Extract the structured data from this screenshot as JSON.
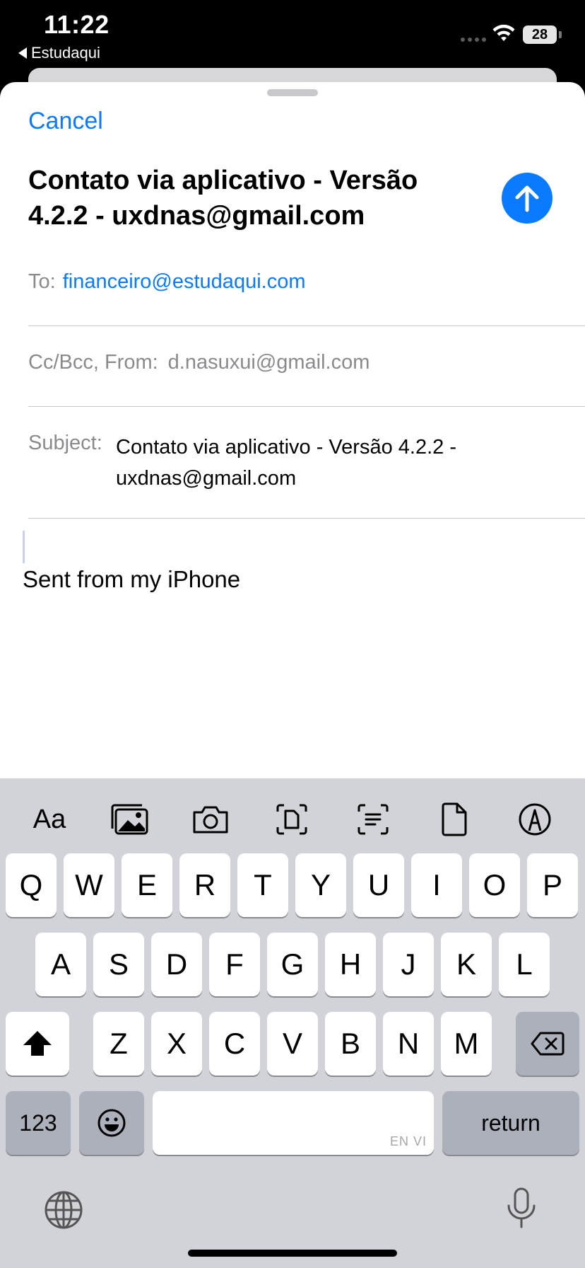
{
  "status_bar": {
    "time": "11:22",
    "back_app": "Estudaqui",
    "battery": "28"
  },
  "compose": {
    "cancel_label": "Cancel",
    "title": "Contato via aplicativo - Versão 4.2.2 - uxdnas@gmail.com",
    "to_label": "To:",
    "to_value": "financeiro@estudaqui.com",
    "cc_label": "Cc/Bcc, From:",
    "cc_value": "d.nasuxui@gmail.com",
    "subject_label": "Subject:",
    "subject_value": "Contato via aplicativo - Versão 4.2.2 - uxdnas@gmail.com",
    "body": "Sent from my iPhone",
    "accent_color": "#0a7aff"
  },
  "keyboard": {
    "toolbar": {
      "format": "Aa",
      "icons": [
        "photo-library-icon",
        "camera-icon",
        "scan-document-icon",
        "scan-text-icon",
        "attach-file-icon",
        "markup-icon"
      ]
    },
    "row1": [
      "Q",
      "W",
      "E",
      "R",
      "T",
      "Y",
      "U",
      "I",
      "O",
      "P"
    ],
    "row2": [
      "A",
      "S",
      "D",
      "F",
      "G",
      "H",
      "J",
      "K",
      "L"
    ],
    "row3": [
      "Z",
      "X",
      "C",
      "V",
      "B",
      "N",
      "M"
    ],
    "numbers_label": "123",
    "space_hint": "EN VI",
    "return_label": "return"
  }
}
